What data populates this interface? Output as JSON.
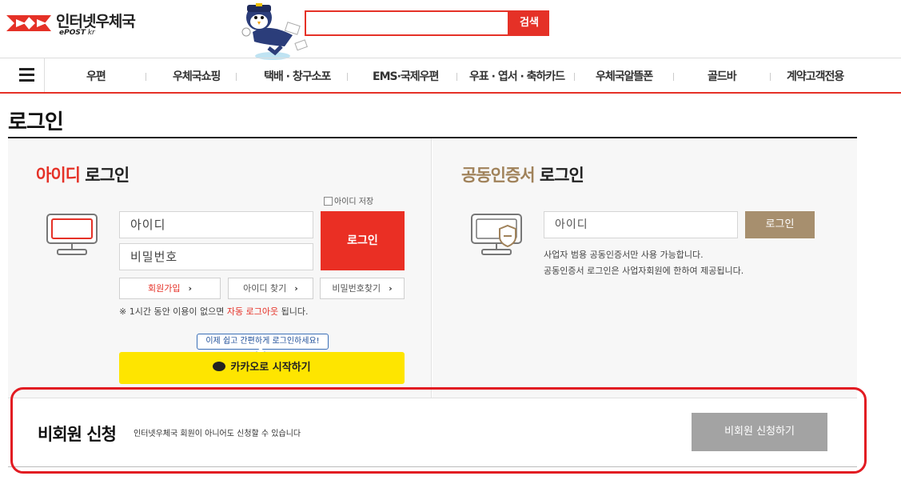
{
  "header": {
    "logo_text": "인터넷우체국",
    "logo_sub_bold": "ePOST",
    "logo_sub": " kr",
    "search_placeholder": "",
    "search_button": "검색"
  },
  "nav": {
    "items": [
      "우편",
      "우체국쇼핑",
      "택배 · 창구소포",
      "EMS·국제우편",
      "우표 · 엽서 · 축하카드",
      "우체국알뜰폰",
      "골드바",
      "계약고객전용"
    ]
  },
  "page": {
    "title": "로그인"
  },
  "id_login": {
    "heading_accent": "아이디",
    "heading_rest": " 로그인",
    "save_id_label": "아이디 저장",
    "id_placeholder": "아이디",
    "pw_placeholder": "비밀번호",
    "login_button": "로그인",
    "signup": "회원가입",
    "find_id": "아이디 찾기",
    "find_pw": "비밀번호찾기",
    "notice_prefix": "※ 1시간 동안 이용이 없으면 ",
    "notice_highlight": "자동 로그아웃",
    "notice_suffix": " 됩니다.",
    "kakao_tip": "이제 쉽고 간편하게 로그인하세요!",
    "kakao_button": "카카오로 시작하기"
  },
  "cert_login": {
    "heading_accent": "공동인증서",
    "heading_rest": " 로그인",
    "id_placeholder": "아이디",
    "login_button": "로그인",
    "note_1": "사업자 범용 공동인증서만 사용 가능합니다.",
    "note_2": "공동인증서 로그인은 사업자회원에 한하여 제공됩니다."
  },
  "guest": {
    "title": "비회원 신청",
    "description": "인터넷우체국 회원이 아니어도 신청할 수 있습니다",
    "button": "비회원 신청하기"
  },
  "colors": {
    "accent_red": "#e53127",
    "cert_tan": "#a78f6e",
    "kakao_yellow": "#fee500"
  }
}
